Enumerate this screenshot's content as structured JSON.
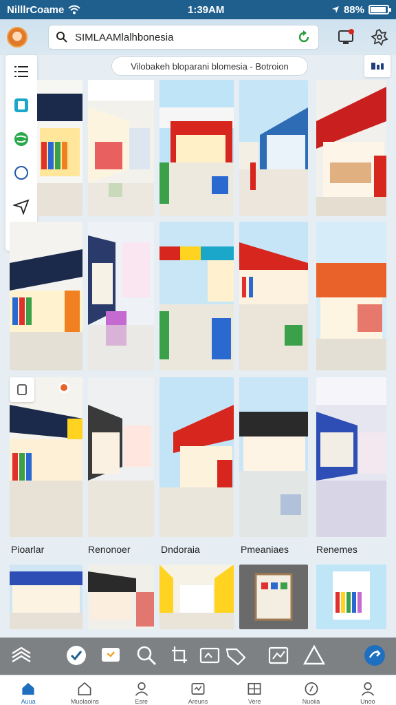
{
  "status_bar": {
    "carrier": "Nilllr​Coame",
    "time": "1:39AM",
    "battery": "88%"
  },
  "search": {
    "value": "SIMLAAMlalhbonesia",
    "placeholder": "SIMLAAMlalhbonesia"
  },
  "caption": "Vilobakeh bloparani blomesia - Botroion",
  "tile_labels": [
    "Pioarlar",
    "Renonoer",
    "Dndoraia",
    "Pmeaniaes",
    "Renemes"
  ],
  "bottom_nav": {
    "items": [
      "Auua",
      "Muolaoins",
      "Esre",
      "Areuns",
      "Vere",
      "Nuoiia",
      "Unoo"
    ]
  },
  "colors": {
    "status_bar": "#1f5f8e",
    "accent": "#1f6fc0",
    "store_red": "#d7261e",
    "store_orange": "#e8622a",
    "store_blue": "#2e6db5"
  }
}
